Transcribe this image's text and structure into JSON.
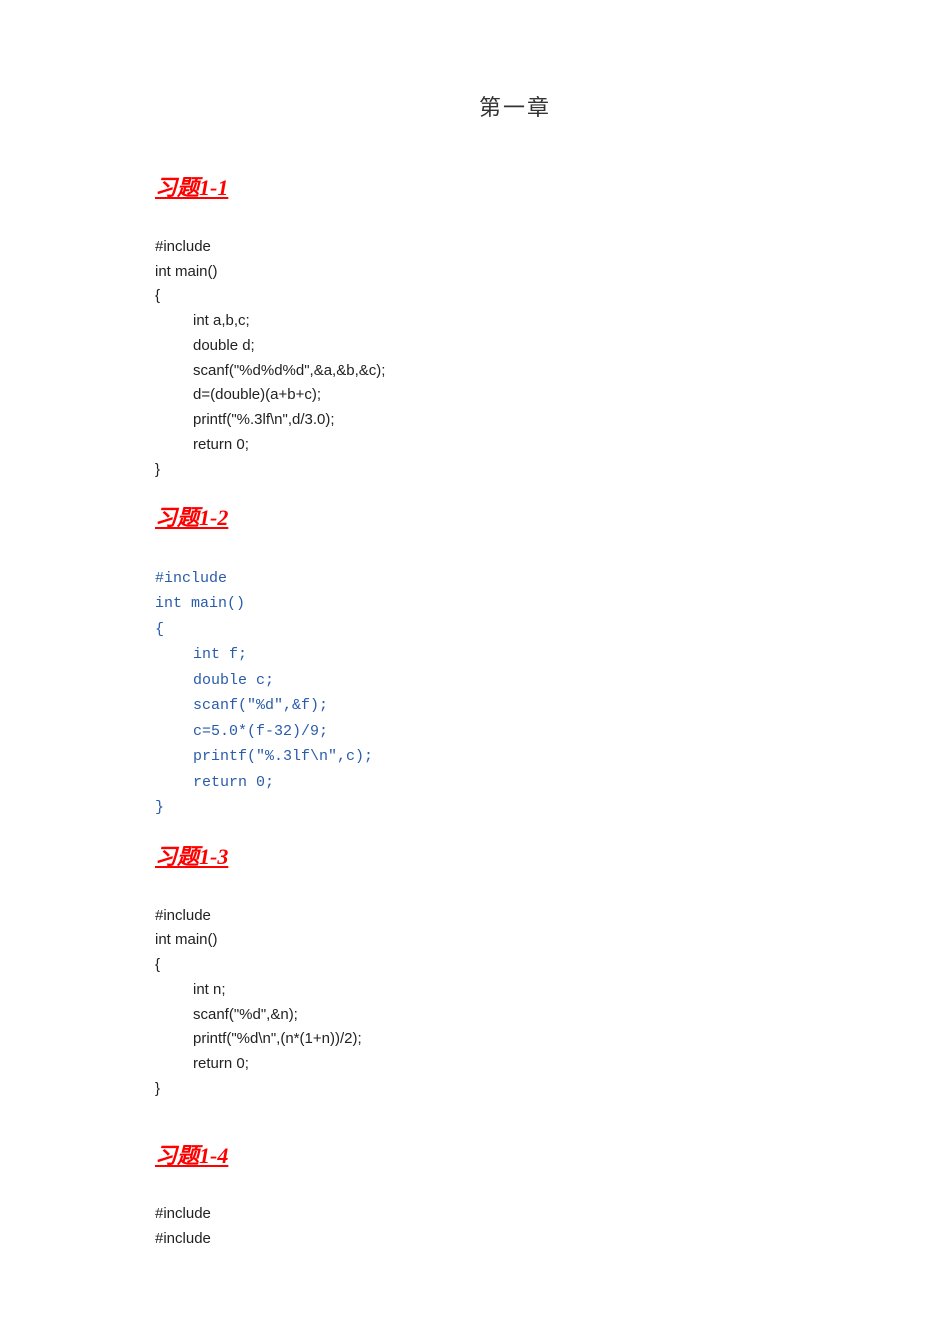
{
  "chapter": "第一章",
  "ex1": {
    "title": "习题1-1",
    "l0": "#include",
    "l1": "int main()",
    "l2": "{",
    "l3": "int a,b,c;",
    "l4": "double d;",
    "l5": "scanf(\"%d%d%d\",&a,&b,&c);",
    "l6": "d=(double)(a+b+c);",
    "l7": "printf(\"%.3lf\\n\",d/3.0);",
    "l8": "return 0;",
    "l9": "}"
  },
  "ex2": {
    "title": "习题1-2",
    "l0": "#include",
    "l1": "int main()",
    "l2": "{",
    "l3": "int f;",
    "l4": "double c;",
    "l5": "scanf(\"%d\",&f);",
    "l6": "c=5.0*(f-32)/9;",
    "l7": "printf(\"%.3lf\\n\",c);",
    "l8": "return 0;",
    "l9": "}"
  },
  "ex3": {
    "title": "习题1-3",
    "l0": "#include",
    "l1": "int main()",
    "l2": "{",
    "l3": "int n;",
    "l4": "scanf(\"%d\",&n);",
    "l5": "printf(\"%d\\n\",(n*(1+n))/2);",
    "l6": "return 0;",
    "l7": "}"
  },
  "ex4": {
    "title": "习题1-4",
    "l0": "#include",
    "l1": "#include"
  }
}
